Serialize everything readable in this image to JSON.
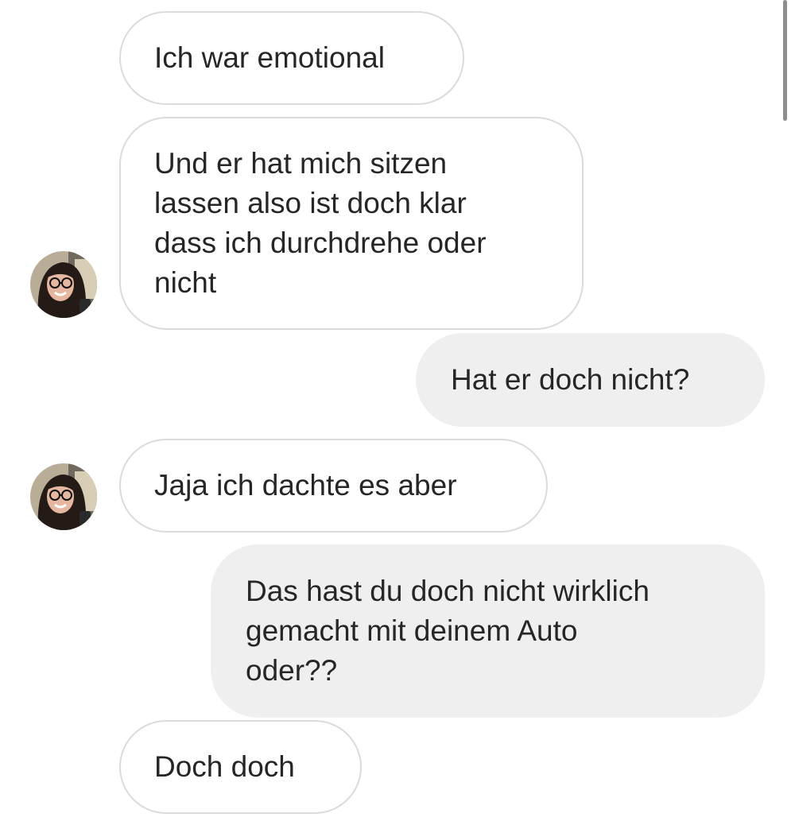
{
  "thread": {
    "messages": [
      {
        "side": "received",
        "text": "Ich war emotional"
      },
      {
        "side": "received",
        "text": "Und er hat mich sitzen\nlassen also ist doch klar\ndass ich durchdrehe oder\nnicht"
      },
      {
        "side": "sent",
        "text": "Hat er doch nicht?"
      },
      {
        "side": "received",
        "text": "Jaja ich dachte es aber"
      },
      {
        "side": "sent",
        "text": "Das hast du doch nicht wirklich\ngemacht mit deinem Auto\noder??"
      },
      {
        "side": "received",
        "text": "Doch doch"
      }
    ]
  },
  "colors": {
    "received_bubble_bg": "#ffffff",
    "received_bubble_border": "#dbdbdb",
    "sent_bubble_bg": "#efefef",
    "text": "#262626",
    "scrollbar": "#8e8e8e"
  },
  "icons": {
    "avatar": "profile-photo-avatar"
  }
}
